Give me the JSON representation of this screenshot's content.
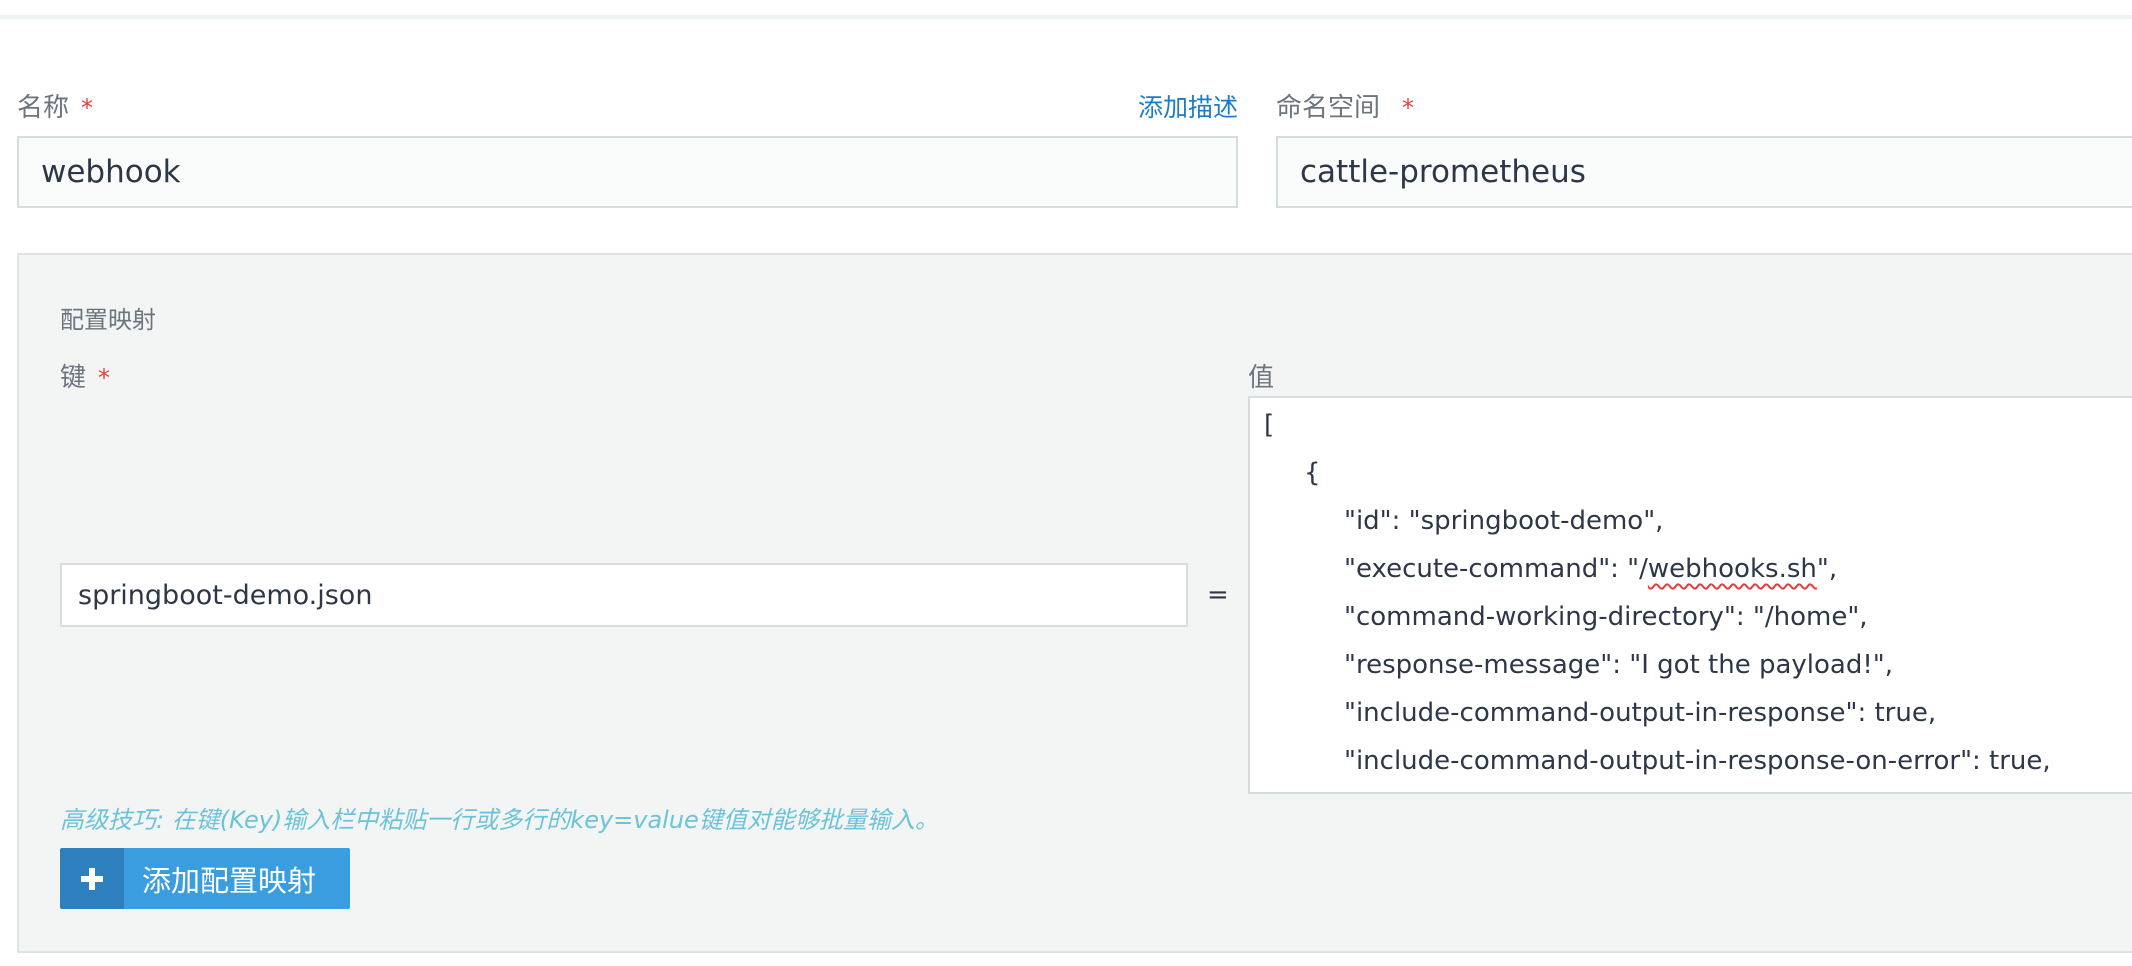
{
  "name_field": {
    "label": "名称",
    "required_mark": "*",
    "value": "webhook",
    "add_description_link": "添加描述"
  },
  "namespace_field": {
    "label": "命名空间",
    "required_mark": "*",
    "value": "cattle-prometheus"
  },
  "config_map": {
    "title": "配置映射",
    "key_label": "键",
    "key_required_mark": "*",
    "value_label": "值",
    "key_value": "springboot-demo.json",
    "equals_sign": "=",
    "value_lines": {
      "l1": "[",
      "l2": "{",
      "l3": "\"id\": \"springboot-demo\",",
      "l4_prefix": "\"execute-command\": \"/",
      "l4_word": "webhooks.sh",
      "l4_suffix": "\",",
      "l5": "\"command-working-directory\": \"/home\",",
      "l6": "\"response-message\": \"I got the payload!\",",
      "l7": "\"include-command-output-in-response\": true,",
      "l8": "\"include-command-output-in-response-on-error\": true,"
    },
    "tip": "高级技巧: 在键(Key)输入栏中粘贴一行或多行的key=value键值对能够批量输入。",
    "add_button_label": "添加配置映射"
  },
  "icons": {
    "add_button_icon": "plus-icon"
  },
  "colors": {
    "link": "#1c7cc7",
    "required": "#e53e3e",
    "tip": "#6cc3d9",
    "button": "#3a9de0",
    "button_icon_bg": "#2d7fbd"
  }
}
